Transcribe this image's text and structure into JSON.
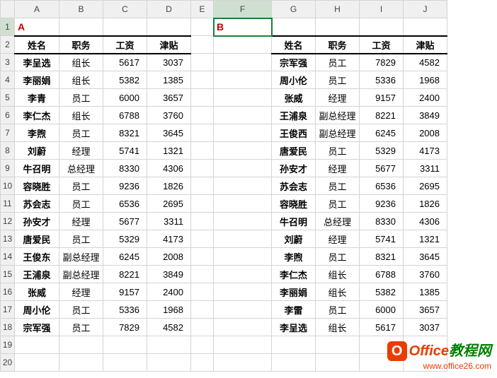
{
  "columns": [
    "A",
    "B",
    "C",
    "D",
    "E",
    "F",
    "G",
    "H",
    "I",
    "J"
  ],
  "active_cell": "F1",
  "labels": {
    "A": "A",
    "B": "B"
  },
  "headers": [
    "姓名",
    "职务",
    "工资",
    "津贴"
  ],
  "rows_left": [
    [
      "李呈选",
      "组长",
      "5617",
      "3037"
    ],
    [
      "李丽娟",
      "组长",
      "5382",
      "1385"
    ],
    [
      "李青",
      "员工",
      "6000",
      "3657"
    ],
    [
      "李仁杰",
      "组长",
      "6788",
      "3760"
    ],
    [
      "李煦",
      "员工",
      "8321",
      "3645"
    ],
    [
      "刘蔚",
      "经理",
      "5741",
      "1321"
    ],
    [
      "牛召明",
      "总经理",
      "8330",
      "4306"
    ],
    [
      "容晓胜",
      "员工",
      "9236",
      "1826"
    ],
    [
      "苏会志",
      "员工",
      "6536",
      "2695"
    ],
    [
      "孙安才",
      "经理",
      "5677",
      "3311"
    ],
    [
      "唐爱民",
      "员工",
      "5329",
      "4173"
    ],
    [
      "王俊东",
      "副总经理",
      "6245",
      "2008"
    ],
    [
      "王浦泉",
      "副总经理",
      "8221",
      "3849"
    ],
    [
      "张威",
      "经理",
      "9157",
      "2400"
    ],
    [
      "周小伦",
      "员工",
      "5336",
      "1968"
    ],
    [
      "宗军强",
      "员工",
      "7829",
      "4582"
    ]
  ],
  "rows_right": [
    [
      "宗军强",
      "员工",
      "7829",
      "4582"
    ],
    [
      "周小伦",
      "员工",
      "5336",
      "1968"
    ],
    [
      "张威",
      "经理",
      "9157",
      "2400"
    ],
    [
      "王浦泉",
      "副总经理",
      "8221",
      "3849"
    ],
    [
      "王俊西",
      "副总经理",
      "6245",
      "2008"
    ],
    [
      "唐爱民",
      "员工",
      "5329",
      "4173"
    ],
    [
      "孙安才",
      "经理",
      "5677",
      "3311"
    ],
    [
      "苏会志",
      "员工",
      "6536",
      "2695"
    ],
    [
      "容晓胜",
      "员工",
      "9236",
      "1826"
    ],
    [
      "牛召明",
      "总经理",
      "8330",
      "4306"
    ],
    [
      "刘蔚",
      "经理",
      "5741",
      "1321"
    ],
    [
      "李煦",
      "员工",
      "8321",
      "3645"
    ],
    [
      "李仁杰",
      "组长",
      "6788",
      "3760"
    ],
    [
      "李丽娟",
      "组长",
      "5382",
      "1385"
    ],
    [
      "李雷",
      "员工",
      "6000",
      "3657"
    ],
    [
      "李呈选",
      "组长",
      "5617",
      "3037"
    ]
  ],
  "row_count": 20,
  "watermark": {
    "brand1": "Office",
    "brand2": "教程网",
    "url": "www.office26.com"
  },
  "chart_data": {
    "type": "table",
    "title": "A",
    "columns": [
      "姓名",
      "职务",
      "工资",
      "津贴"
    ],
    "series": []
  }
}
